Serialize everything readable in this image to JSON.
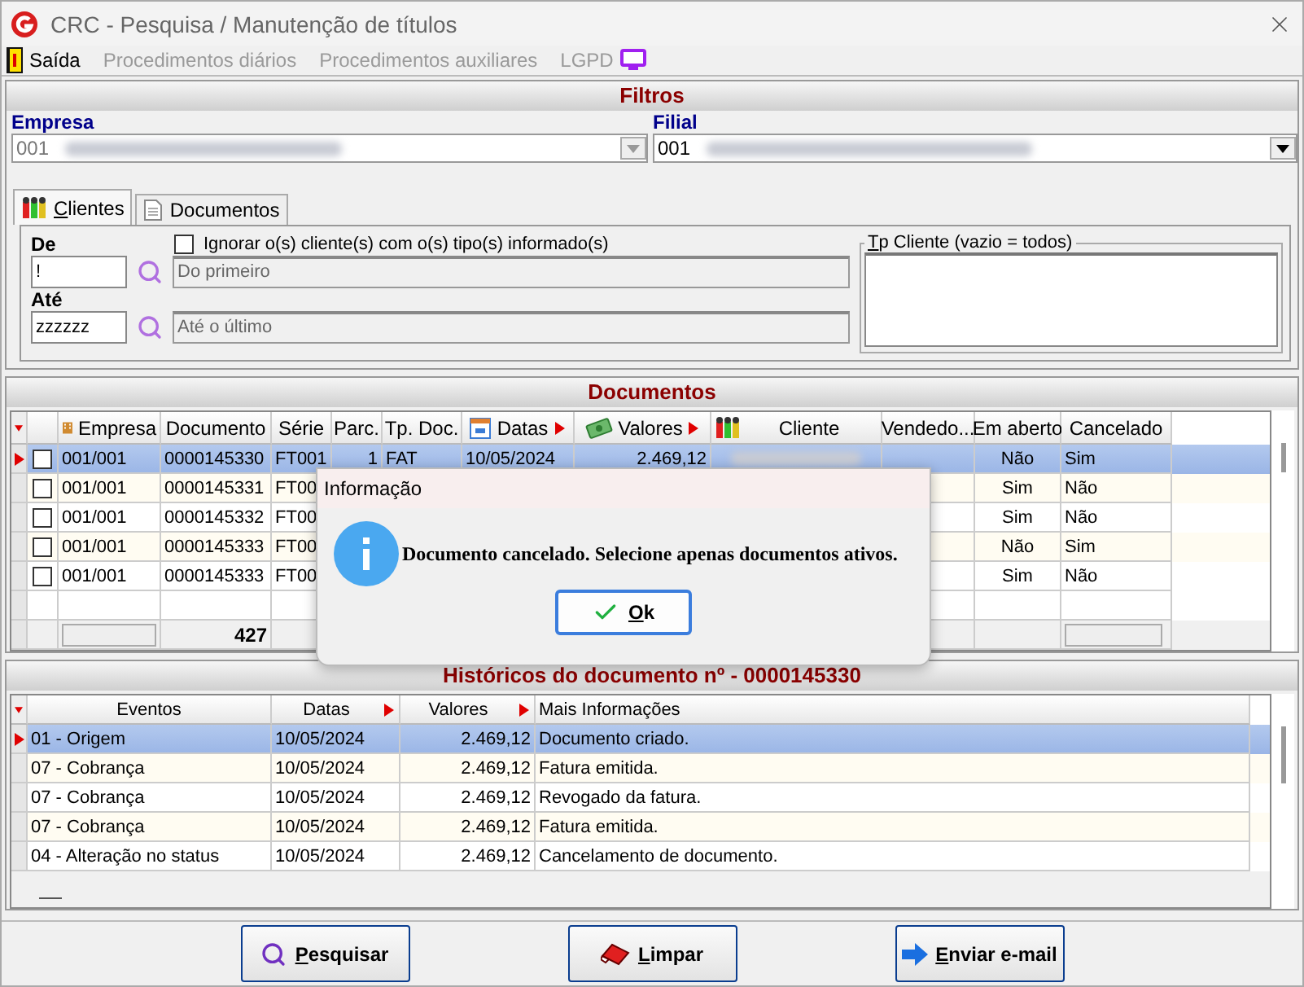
{
  "window": {
    "title": "CRC - Pesquisa / Manutenção de títulos"
  },
  "menu": [
    {
      "label": "Saída",
      "disabled": false
    },
    {
      "label": "Procedimentos diários",
      "disabled": true
    },
    {
      "label": "Procedimentos auxiliares",
      "disabled": true
    },
    {
      "label": "LGPD",
      "disabled": true
    }
  ],
  "filters": {
    "title": "Filtros",
    "empresa": {
      "label": "Empresa",
      "code": "001",
      "disabled": true
    },
    "filial": {
      "label": "Filial",
      "code": "001",
      "disabled": false
    },
    "tabs": [
      {
        "label": "Clientes",
        "selected": true
      },
      {
        "label": "Documentos",
        "selected": false
      }
    ],
    "de": {
      "label": "De",
      "value": "!",
      "description": "Do primeiro"
    },
    "ate": {
      "label": "Até",
      "value": "zzzzzz",
      "description": "Até o último"
    },
    "ignore": {
      "label": "Ignorar o(s) cliente(s) com o(s) tipo(s) informado(s)",
      "checked": false
    },
    "tp_cliente": {
      "label": "Tp Cliente (vazio = todos)"
    }
  },
  "documents": {
    "title": "Documentos",
    "columns": [
      "Empresa",
      "Documento",
      "Série",
      "Parc.",
      "Tp. Doc.",
      "Datas",
      "Valores",
      "Cliente",
      "Vendedo...",
      "Em aberto",
      "Cancelado"
    ],
    "rows": [
      {
        "selected": true,
        "checked": false,
        "empresa": "001/001",
        "documento": "0000145330",
        "serie": "FT001",
        "parc": "1",
        "tp_doc": "FAT",
        "data": "10/05/2024",
        "valor": "2.469,12",
        "em_aberto": "Não",
        "cancelado": "Sim"
      },
      {
        "selected": false,
        "checked": false,
        "empresa": "001/001",
        "documento": "0000145331",
        "serie": "FT00",
        "em_aberto": "Sim",
        "cancelado": "Não"
      },
      {
        "selected": false,
        "checked": false,
        "empresa": "001/001",
        "documento": "0000145332",
        "serie": "FT00",
        "em_aberto": "Sim",
        "cancelado": "Não"
      },
      {
        "selected": false,
        "checked": false,
        "empresa": "001/001",
        "documento": "0000145333",
        "serie": "FT00",
        "em_aberto": "Não",
        "cancelado": "Sim"
      },
      {
        "selected": false,
        "checked": false,
        "empresa": "001/001",
        "documento": "0000145333",
        "serie": "FT00",
        "em_aberto": "Sim",
        "cancelado": "Não"
      }
    ],
    "total": "427"
  },
  "history": {
    "title": "Históricos do documento nº - 0000145330",
    "columns": [
      "Eventos",
      "Datas",
      "Valores",
      "Mais Informações"
    ],
    "rows": [
      {
        "selected": true,
        "evento": "01 - Origem",
        "data": "10/05/2024",
        "valor": "2.469,12",
        "info": "Documento criado."
      },
      {
        "selected": false,
        "evento": "07 - Cobrança",
        "data": "10/05/2024",
        "valor": "2.469,12",
        "info": "Fatura emitida."
      },
      {
        "selected": false,
        "evento": "07 - Cobrança",
        "data": "10/05/2024",
        "valor": "2.469,12",
        "info": "Revogado da fatura."
      },
      {
        "selected": false,
        "evento": "07 - Cobrança",
        "data": "10/05/2024",
        "valor": "2.469,12",
        "info": "Fatura emitida."
      },
      {
        "selected": false,
        "evento": "04 - Alteração no status",
        "data": "10/05/2024",
        "valor": "2.469,12",
        "info": "Cancelamento de documento."
      }
    ]
  },
  "buttons": [
    {
      "kind": "search",
      "label": "Pesquisar"
    },
    {
      "kind": "clear",
      "label": "Limpar"
    },
    {
      "kind": "email",
      "label": "Enviar e-mail"
    }
  ],
  "dialog": {
    "title": "Informação",
    "message": "Documento cancelado. Selecione apenas documentos ativos.",
    "button": "Ok"
  }
}
